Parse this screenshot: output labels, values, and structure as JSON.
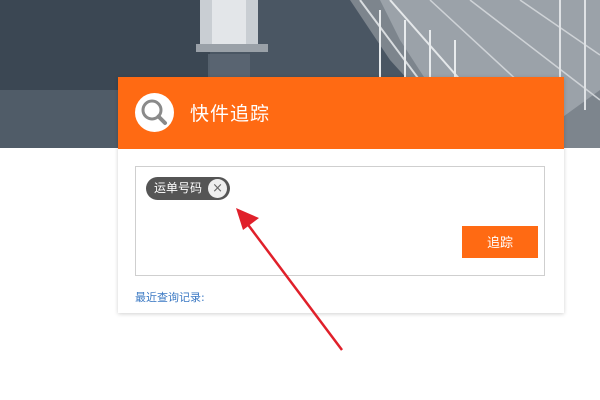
{
  "tracking_card": {
    "title": "快件追踪",
    "tag_label": "运单号码",
    "tag_close_symbol": "×",
    "track_button_label": "追踪",
    "recent_label": "最近查询记录:"
  },
  "colors": {
    "accent": "#ff6a13",
    "tag_bg": "#555555",
    "link": "#3a78c3",
    "annotation_arrow": "#e0202a"
  },
  "icons": {
    "header_icon": "search-icon",
    "tag_close_icon": "close-icon"
  }
}
